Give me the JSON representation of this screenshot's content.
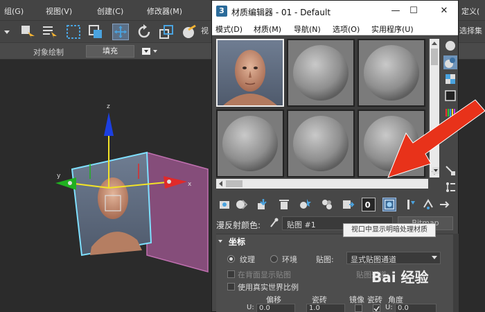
{
  "app": {
    "menus": [
      "组(G)",
      "视图(V)",
      "创建(C)",
      "修改器(M)",
      "定义(",
      "选择集"
    ],
    "ribbon": {
      "label": "对象绘制",
      "tab": "填充"
    }
  },
  "material_editor": {
    "title": "材质编辑器 - 01 - Default",
    "menus": [
      "模式(D)",
      "材质(M)",
      "导航(N)",
      "选项(O)",
      "实用程序(U)"
    ],
    "diffuse_label": "漫反射颜色:",
    "map_name": "贴图 #1",
    "bitmap_label": "Bitmap",
    "tooltip": "视口中显示明暗处理材质",
    "rollout": {
      "title": "坐标",
      "texture": "纹理",
      "environment": "环境",
      "map_label": "贴图:",
      "map_channel": "显式贴图通道",
      "show_back": "在背面显示贴图",
      "map_channel_label": "贴图通道:",
      "real_world": "使用真实世界比例",
      "offset": "偏移",
      "tiling": "瓷砖",
      "mirror": "镜像",
      "tile": "瓷砖",
      "angle": "角度",
      "u_label": "U:",
      "offset_u": "0.0",
      "tiling_u": "1.0",
      "angle_u": "0.0"
    }
  },
  "watermark": "Bai 经验",
  "colors": {
    "arrow": "#e8321a",
    "active_slot_border": "#eeeeee"
  }
}
